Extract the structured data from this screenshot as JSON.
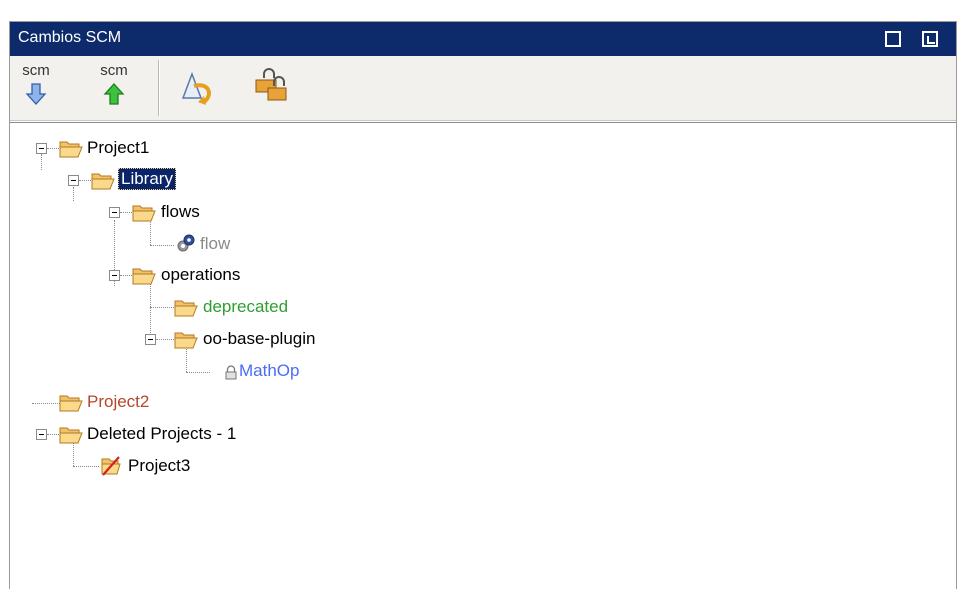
{
  "panel": {
    "title": "Cambios SCM"
  },
  "toolbar": {
    "update_label": "scm",
    "commit_label": "scm"
  },
  "tree": {
    "nodes": [
      {
        "label": "Project1",
        "color": "#000000"
      },
      {
        "label": "Library",
        "color": "#ffffff"
      },
      {
        "label": "flows",
        "color": "#000000"
      },
      {
        "label": "flow",
        "color": "#8a8a8a"
      },
      {
        "label": "operations",
        "color": "#000000"
      },
      {
        "label": "deprecated",
        "color": "#2e9e2e"
      },
      {
        "label": "oo-base-plugin",
        "color": "#000000"
      },
      {
        "label": "MathOp",
        "color": "#4a6cf7"
      },
      {
        "label": "Project2",
        "color": "#b5472a"
      },
      {
        "label": "Deleted Projects - 1",
        "color": "#000000"
      },
      {
        "label": "Project3",
        "color": "#000000"
      }
    ],
    "selected": "Library"
  },
  "colors": {
    "titlebar": "#0d2a6b",
    "folder": "#f4c06a",
    "selection": "#0a246a"
  }
}
